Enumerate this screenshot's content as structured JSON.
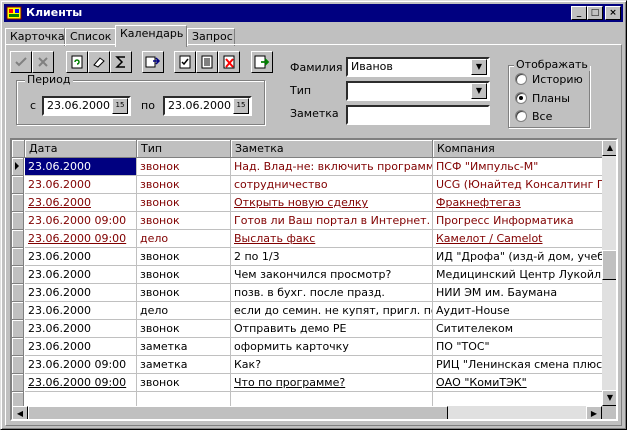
{
  "window": {
    "title": "Клиенты",
    "controls": {
      "minimize": "_",
      "maximize": "□",
      "close": "×"
    }
  },
  "tabs": [
    {
      "label": "Карточка",
      "active": false
    },
    {
      "label": "Список",
      "active": false
    },
    {
      "label": "Календарь",
      "active": true
    },
    {
      "label": "Запрос",
      "active": false
    }
  ],
  "toolbar": {
    "icons": [
      "check-icon",
      "cancel-icon",
      "refresh-icon",
      "eraser-icon",
      "sigma-icon",
      "copy-icon",
      "report-icon",
      "document-icon",
      "delete-icon",
      "export-icon"
    ]
  },
  "period": {
    "title": "Период",
    "from_label": "с",
    "from_value": "23.06.2000",
    "to_label": "по",
    "to_value": "23.06.2000",
    "cal_label": "15"
  },
  "filters": {
    "surname_label": "Фамилия",
    "surname_value": "Иванов",
    "type_label": "Тип",
    "type_value": "",
    "note_label": "Заметка",
    "note_value": ""
  },
  "display": {
    "title": "Отображать",
    "options": [
      {
        "label": "Историю",
        "selected": false
      },
      {
        "label": "Планы",
        "selected": true
      },
      {
        "label": "Все",
        "selected": false
      }
    ]
  },
  "colors": {
    "title_bar": "#000080",
    "text_dark_red": "#800000",
    "text_black": "#000000",
    "selected_cell": "#000080"
  },
  "table": {
    "columns": [
      "Дата",
      "Тип",
      "Заметка",
      "Компания"
    ],
    "rows": [
      {
        "date": "23.06.2000",
        "type": "звонок",
        "note": "Над. Влад-не: включить программы в",
        "company": "ПСФ \"Импульс-М\"",
        "color": "red",
        "link": false,
        "current": true
      },
      {
        "date": "23.06.2000",
        "type": "звонок",
        "note": "сотрудничество",
        "company": "UCG (Юнайтед Консалтинг Групп",
        "color": "red",
        "link": false,
        "current": false
      },
      {
        "date": "23.06.2000",
        "type": "звонок",
        "note": "Открыть новую сделку",
        "company": "Фракнефтегаз",
        "color": "red",
        "link": true,
        "current": false
      },
      {
        "date": "23.06.2000 09:00",
        "type": "звонок",
        "note": "Готов ли Ваш портал в Интернет. Може",
        "company": "Прогресс Информатика",
        "color": "red",
        "link": false,
        "current": false
      },
      {
        "date": "23.06.2000 09:00",
        "type": "дело",
        "note": "Выслать факс",
        "company": "Камелот / Camelot",
        "color": "red",
        "link": true,
        "current": false
      },
      {
        "date": "23.06.2000",
        "type": "звонок",
        "note": "2 по 1/3",
        "company": "ИД \"Дрофа\" (изд-й дом, учеб. ли",
        "color": "black",
        "link": false,
        "current": false
      },
      {
        "date": "23.06.2000",
        "type": "звонок",
        "note": "Чем закончился просмотр?",
        "company": "Медицинский Центр  Лукойл",
        "color": "black",
        "link": false,
        "current": false
      },
      {
        "date": "23.06.2000",
        "type": "звонок",
        "note": "позв. в бухг. после празд.",
        "company": "НИИ ЭМ им. Баумана",
        "color": "black",
        "link": false,
        "current": false
      },
      {
        "date": "23.06.2000",
        "type": "дело",
        "note": "если до семин. не купят, пригл.  по АЕ.",
        "company": "Аудит-House",
        "color": "black",
        "link": false,
        "current": false
      },
      {
        "date": "23.06.2000",
        "type": "звонок",
        "note": "Отправить демо РЕ",
        "company": "Ситителеком",
        "color": "black",
        "link": false,
        "current": false
      },
      {
        "date": "23.06.2000",
        "type": "заметка",
        "note": "оформить карточку",
        "company": "ПО \"ТОС\"",
        "color": "black",
        "link": false,
        "current": false
      },
      {
        "date": "23.06.2000 09:00",
        "type": "заметка",
        "note": "Как?",
        "company": "РИЦ \"Ленинская смена плюс\"",
        "color": "black",
        "link": false,
        "current": false
      },
      {
        "date": "23.06.2000 09:00",
        "type": "звонок",
        "note": "Что по программе?",
        "company": "ОАО \"КомиТЭК\"",
        "color": "black",
        "link": true,
        "current": false
      },
      {
        "date": "",
        "type": "",
        "note": "",
        "company": "",
        "color": "black",
        "link": false,
        "current": false
      }
    ]
  }
}
